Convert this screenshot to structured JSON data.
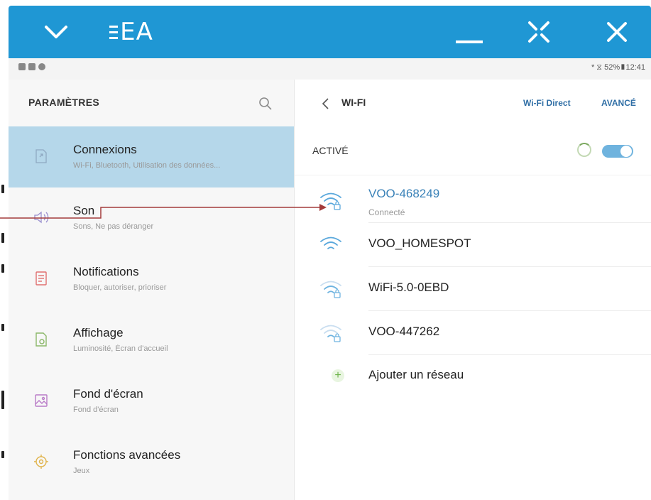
{
  "titlebar": {
    "app_logo": "EA",
    "icons": {
      "collapse": "chevron-down-icon",
      "minimize": "minimize-icon",
      "fullscreen": "fullscreen-icon",
      "close": "close-icon"
    }
  },
  "statusbar": {
    "right_text": "* ⧖ 52%▮12:41"
  },
  "settings": {
    "title": "PARAMÈTRES",
    "items": [
      {
        "title": "Connexions",
        "subtitle": "Wi-Fi, Bluetooth, Utilisation des données...",
        "icon": "connections-icon",
        "selected": true
      },
      {
        "title": "Son",
        "subtitle": "Sons, Ne pas déranger",
        "icon": "sound-icon"
      },
      {
        "title": "Notifications",
        "subtitle": "Bloquer, autoriser, prioriser",
        "icon": "notifications-icon"
      },
      {
        "title": "Affichage",
        "subtitle": "Luminosité, Écran d'accueil",
        "icon": "display-icon"
      },
      {
        "title": "Fond d'écran",
        "subtitle": "Fond d'écran",
        "icon": "wallpaper-icon"
      },
      {
        "title": "Fonctions avancées",
        "subtitle": "Jeux",
        "icon": "advanced-features-icon"
      }
    ]
  },
  "wifi": {
    "title": "WI-FI",
    "direct_label": "Wi-Fi Direct",
    "advanced_label": "AVANCÉ",
    "active_label": "ACTIVÉ",
    "toggle_on": true,
    "networks": [
      {
        "name": "VOO-468249",
        "status": "Connecté",
        "secured": true
      },
      {
        "name": "VOO_HOMESPOT",
        "status": "",
        "secured": false
      },
      {
        "name": "WiFi-5.0-0EBD",
        "status": "",
        "secured": true
      },
      {
        "name": "VOO-447262",
        "status": "",
        "secured": true
      }
    ],
    "add_network_label": "Ajouter un réseau"
  },
  "colors": {
    "titlebar": "#1f97d4",
    "selected_row": "#b5d7ea",
    "connected": "#3a82b8",
    "callout": "#a33b3b"
  }
}
